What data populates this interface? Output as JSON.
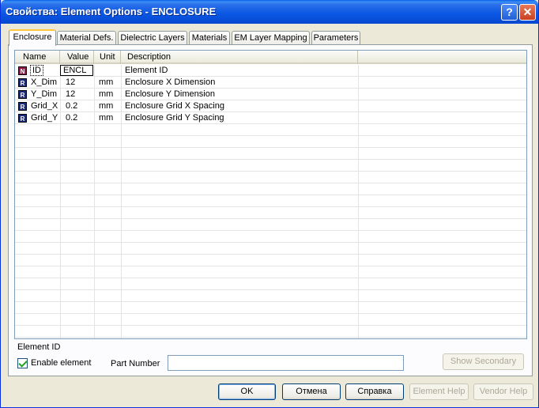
{
  "window": {
    "title": "Свойства: Element Options - ENCLOSURE",
    "help_glyph": "?",
    "close_glyph": "✕"
  },
  "tabs": [
    {
      "label": "Enclosure",
      "active": true
    },
    {
      "label": "Material Defs."
    },
    {
      "label": "Dielectric Layers"
    },
    {
      "label": "Materials"
    },
    {
      "label": "EM Layer Mapping"
    },
    {
      "label": "Parameters"
    }
  ],
  "grid": {
    "columns": [
      "Name",
      "Value",
      "Unit",
      "Description"
    ],
    "rows": [
      {
        "badge": "N",
        "name": "ID",
        "value": "ENCL",
        "unit": "",
        "description": "Element ID"
      },
      {
        "badge": "R",
        "name": "X_Dim",
        "value": "12",
        "unit": "mm",
        "description": "Enclosure X Dimension"
      },
      {
        "badge": "R",
        "name": "Y_Dim",
        "value": "12",
        "unit": "mm",
        "description": "Enclosure Y Dimension"
      },
      {
        "badge": "R",
        "name": "Grid_X",
        "value": "0.2",
        "unit": "mm",
        "description": "Enclosure Grid X Spacing"
      },
      {
        "badge": "R",
        "name": "Grid_Y",
        "value": "0.2",
        "unit": "mm",
        "description": "Enclosure Grid Y Spacing"
      }
    ]
  },
  "description_text": "Element ID",
  "enable_element": {
    "label": "Enable element",
    "checked": true
  },
  "part_number": {
    "label": "Part Number",
    "value": ""
  },
  "buttons": {
    "show_secondary": "Show Secondary",
    "ok": "OK",
    "cancel": "Отмена",
    "help": "Справка",
    "element_help": "Element Help",
    "vendor_help": "Vendor Help"
  },
  "colors": {
    "titlebar": "#0956e3",
    "active_tab_accent": "#ffc83c",
    "badge_n": "#8b1a4a",
    "badge_r": "#1a2a7a"
  }
}
